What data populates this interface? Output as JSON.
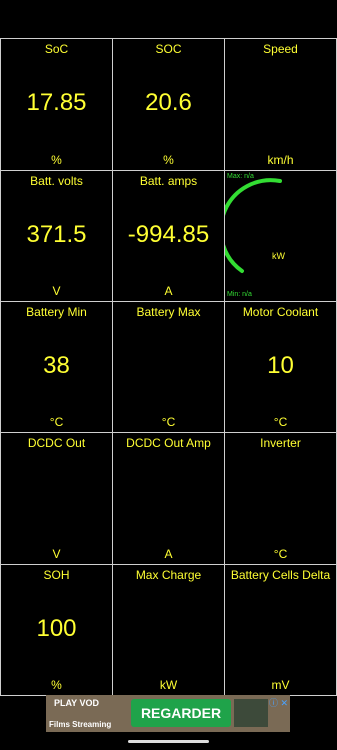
{
  "cells": [
    {
      "label": "SoC",
      "value": "17.85",
      "unit": "%"
    },
    {
      "label": "SOC",
      "value": "20.6",
      "unit": "%"
    },
    {
      "label": "Speed",
      "value": "",
      "unit": "km/h"
    },
    {
      "label": "Batt. volts",
      "value": "371.5",
      "unit": "V"
    },
    {
      "label": "Batt. amps",
      "value": "-994.85",
      "unit": "A"
    },
    {
      "label": "",
      "value": "",
      "unit": ""
    },
    {
      "label": "Battery Min",
      "value": "38",
      "unit": "°C"
    },
    {
      "label": "Battery Max",
      "value": "",
      "unit": "°C"
    },
    {
      "label": "Motor Coolant",
      "value": "10",
      "unit": "°C"
    },
    {
      "label": "DCDC Out",
      "value": "",
      "unit": "V"
    },
    {
      "label": "DCDC Out Amp",
      "value": "",
      "unit": "A"
    },
    {
      "label": "Inverter",
      "value": "",
      "unit": "°C"
    },
    {
      "label": "SOH",
      "value": "100",
      "unit": "%"
    },
    {
      "label": "Max Charge",
      "value": "",
      "unit": "kW"
    },
    {
      "label": "Battery Cells Delta",
      "value": "",
      "unit": "mV"
    }
  ],
  "gauge": {
    "max": "Max: n/a",
    "min": "Min: n/a",
    "unit": "kW",
    "color": "#33dd33"
  },
  "ad": {
    "brand": "PLAY VOD",
    "subtitle": "Films Streaming",
    "button": "REGARDER",
    "close": "ⓘ ✕"
  },
  "colors": {
    "value": "#ffff33",
    "grid": "#cfcfcf",
    "background": "#000000"
  }
}
